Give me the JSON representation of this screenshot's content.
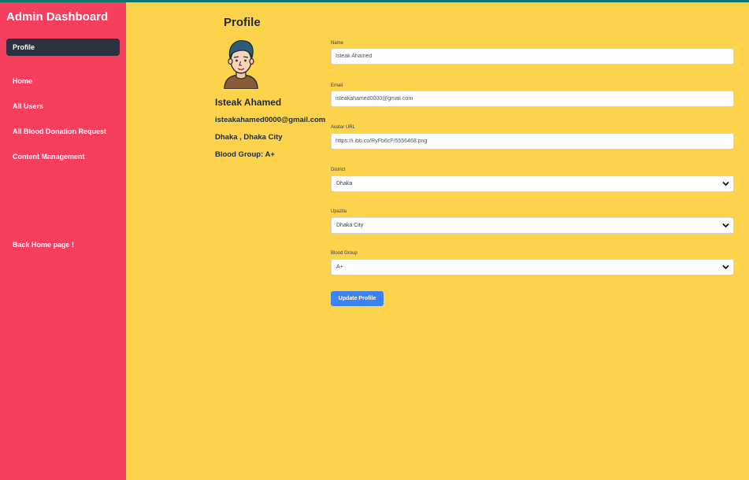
{
  "sidebar": {
    "title": "Admin Dashboard",
    "active_item": "Profile",
    "items": [
      "Home",
      "All Users",
      "All Blood Donation Request",
      "Content Management"
    ],
    "back_link": "Back Home page !"
  },
  "profile": {
    "heading": "Profile",
    "name": "Isteak Ahamed",
    "email": "isteakahamed0000@gmail.com",
    "location": "Dhaka , Dhaka City",
    "blood_group": "Blood Group: A+"
  },
  "form": {
    "name_label": "Name",
    "name_value": "Isteak Ahamed",
    "email_label": "Email",
    "email_value": "isteakahamed0000@gmail.com",
    "avatar_label": "Avatar URL",
    "avatar_value": "https://i.ibb.co/RyFb6cF/5556468.png",
    "district_label": "District",
    "district_value": "Dhaka",
    "upazila_label": "Upazila",
    "upazila_value": "Dhaka City",
    "blood_group_label": "Blood Group",
    "blood_group_value": "A+",
    "submit_label": "Update Profile"
  },
  "colors": {
    "sidebar_bg": "#f63e5f",
    "active_item_bg": "#2b3240",
    "main_bg": "#fdd34b",
    "button_bg": "#3b82f6",
    "top_line": "#0f766e"
  }
}
